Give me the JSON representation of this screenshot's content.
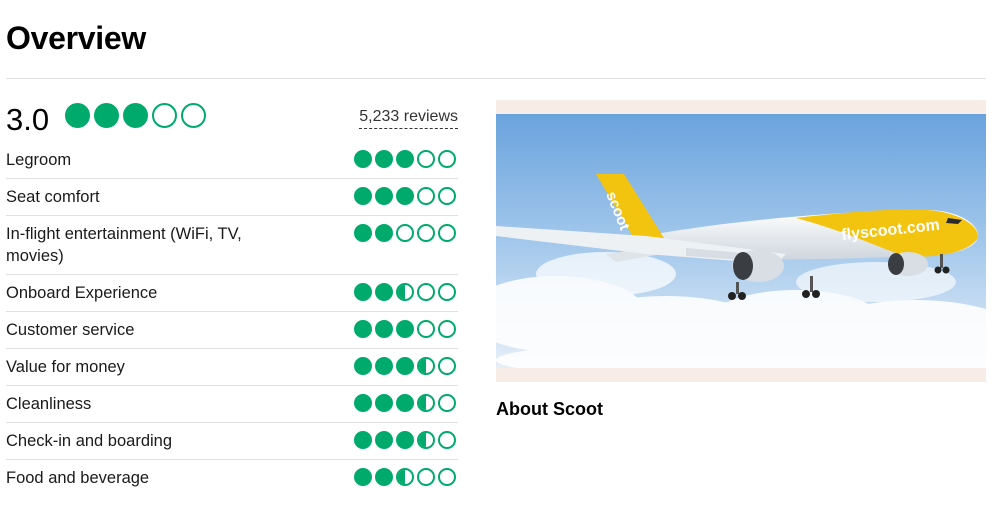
{
  "header": {
    "title": "Overview"
  },
  "overall": {
    "score": "3.0",
    "rating": 3.0,
    "reviews_label": "5,233 reviews"
  },
  "categories": [
    {
      "label": "Legroom",
      "rating": 3.0
    },
    {
      "label": "Seat comfort",
      "rating": 3.0
    },
    {
      "label": "In-flight entertainment (WiFi, TV, movies)",
      "rating": 2.0
    },
    {
      "label": "Onboard Experience",
      "rating": 2.5
    },
    {
      "label": "Customer service",
      "rating": 3.0
    },
    {
      "label": "Value for money",
      "rating": 3.5
    },
    {
      "label": "Cleanliness",
      "rating": 3.5
    },
    {
      "label": "Check-in and boarding",
      "rating": 3.5
    },
    {
      "label": "Food and beverage",
      "rating": 2.5
    }
  ],
  "photo": {
    "livery_text": "flyscoot.com",
    "tail_text": "scoot"
  },
  "about": {
    "title": "About Scoot"
  },
  "colors": {
    "bubble": "#00aa6c",
    "livery_yellow": "#f2c40f",
    "sky": "#7fb2e6"
  }
}
